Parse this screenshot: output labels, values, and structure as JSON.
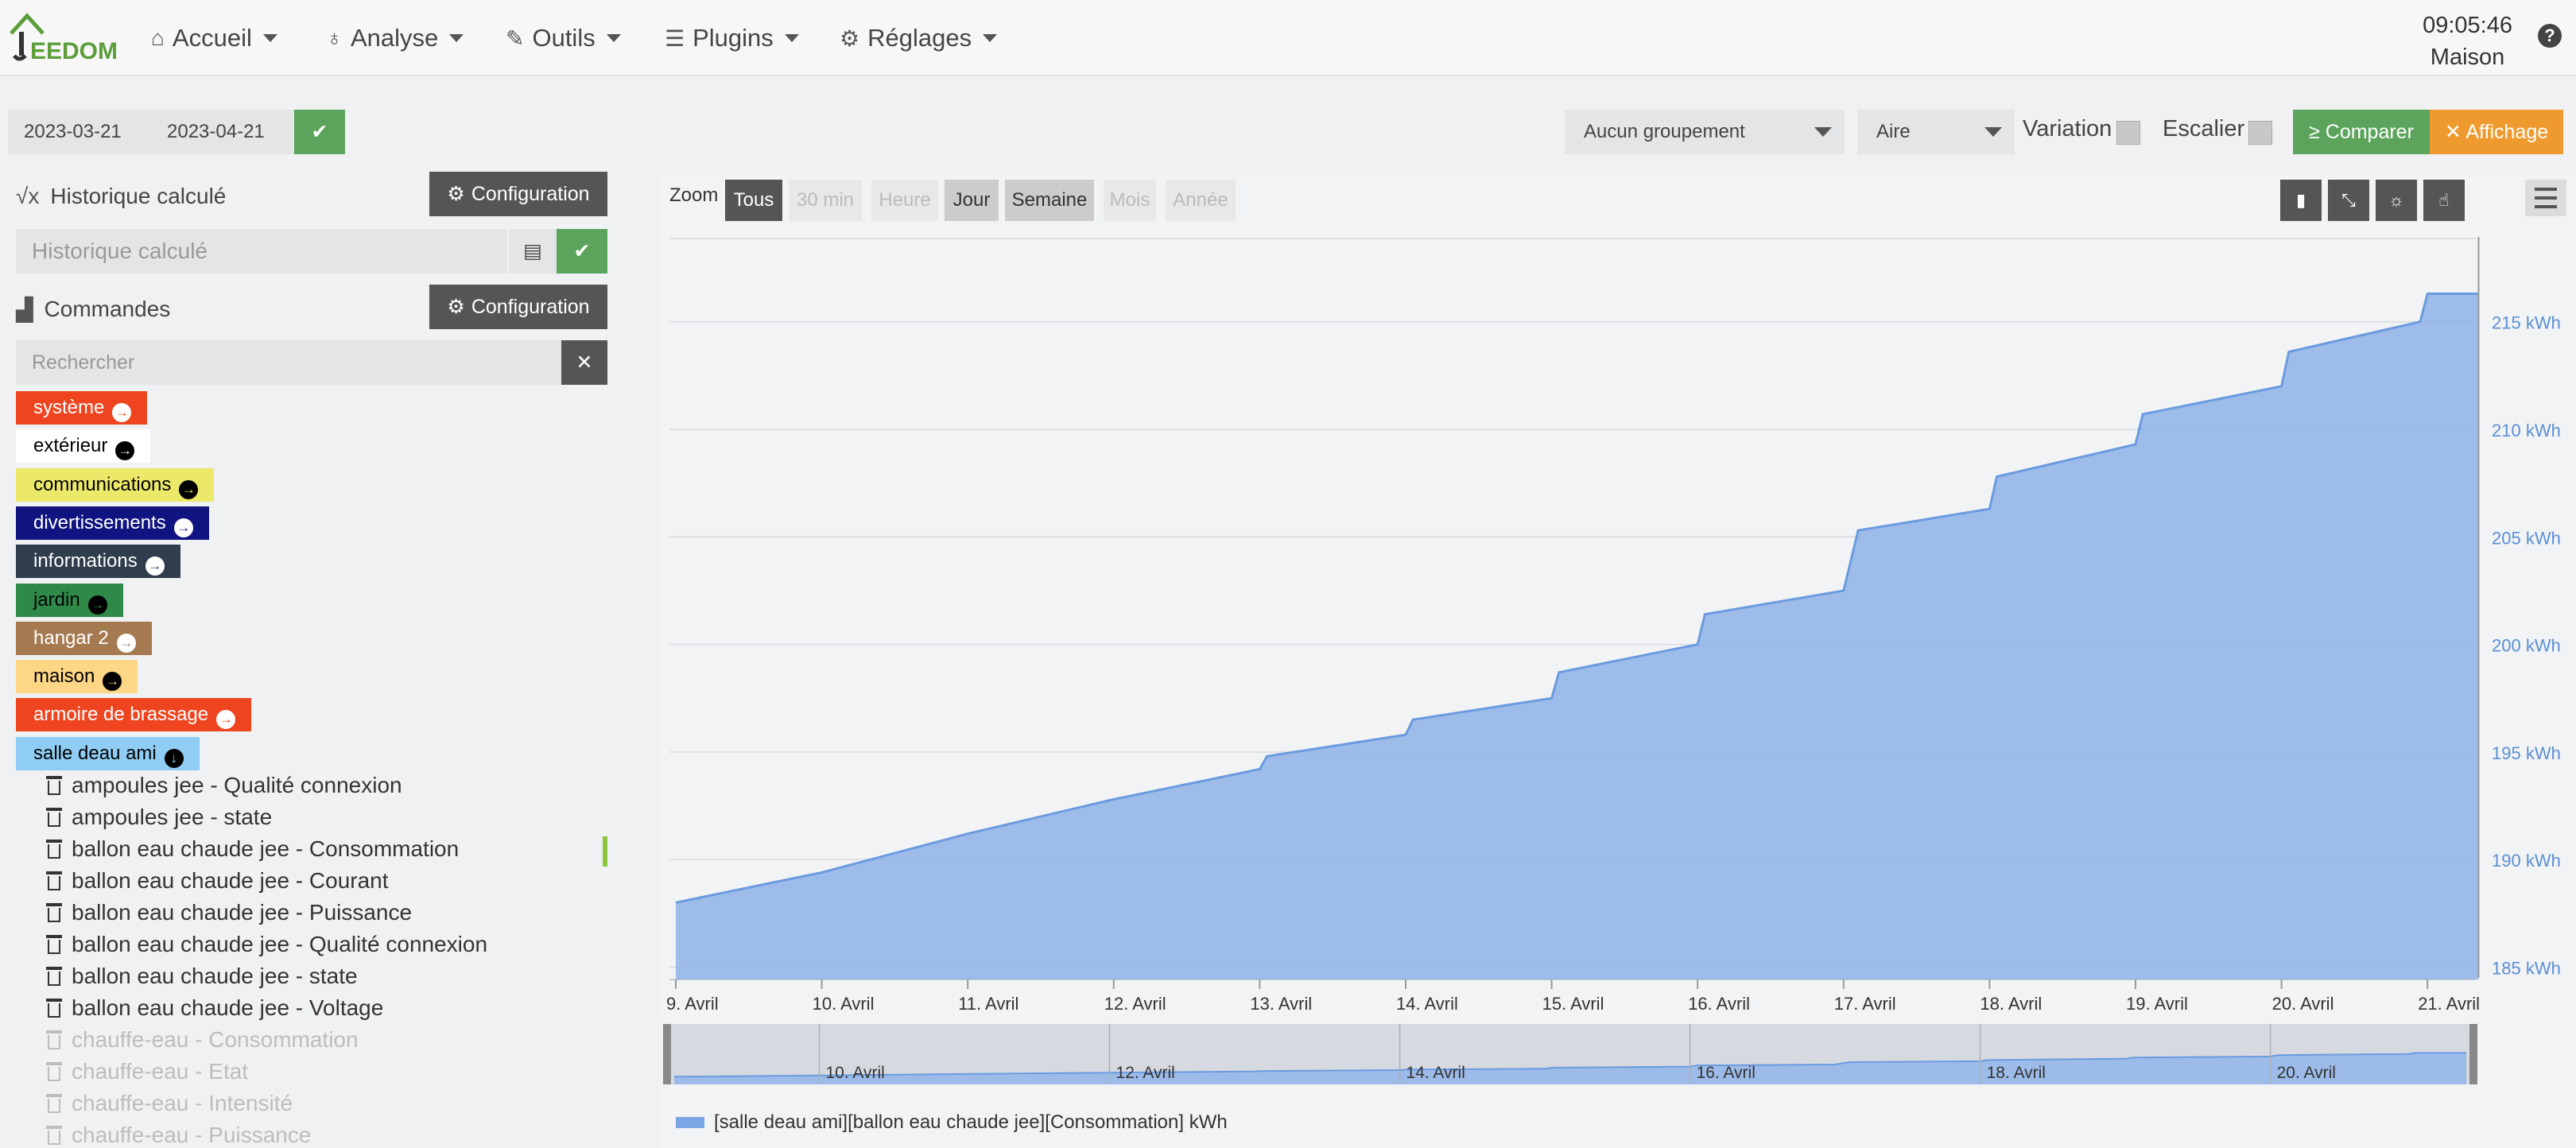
{
  "nav": {
    "logo_text": "EEDOM",
    "items": [
      {
        "label": "Accueil",
        "icon": "home-icon"
      },
      {
        "label": "Analyse",
        "icon": "stethoscope-icon"
      },
      {
        "label": "Outils",
        "icon": "wrench-icon"
      },
      {
        "label": "Plugins",
        "icon": "tasks-icon"
      },
      {
        "label": "Réglages",
        "icon": "cogs-icon"
      }
    ],
    "time": "09:05:46",
    "location": "Maison",
    "help_icon": "question-circle-icon"
  },
  "dates": {
    "start": "2023-03-21",
    "end": "2023-04-21"
  },
  "toolbar": {
    "grouping": "Aucun groupement",
    "chart_type": "Aire",
    "variation_label": "Variation",
    "escalier_label": "Escalier",
    "compare_label": "≥ Comparer",
    "affichage_label": "✕ Affichage"
  },
  "sidebar": {
    "calc_title": "Historique calculé",
    "config_label": "Configuration",
    "calc_placeholder": "Historique calculé",
    "commands_title": "Commandes",
    "search_placeholder": "Rechercher",
    "tags": [
      {
        "label": "système",
        "bg": "#ee4520",
        "fg": "#ffffff"
      },
      {
        "label": "extérieur",
        "bg": "#ffffff",
        "fg": "#000000"
      },
      {
        "label": "communications",
        "bg": "#ece86a",
        "fg": "#000000"
      },
      {
        "label": "divertissements",
        "bg": "#101480",
        "fg": "#ffffff"
      },
      {
        "label": "informations",
        "bg": "#2f3d4d",
        "fg": "#ffffff"
      },
      {
        "label": "jardin",
        "bg": "#2f8a4a",
        "fg": "#000000"
      },
      {
        "label": "hangar 2",
        "bg": "#a57a50",
        "fg": "#ffffff"
      },
      {
        "label": "maison",
        "bg": "#fdd786",
        "fg": "#000000"
      },
      {
        "label": "armoire de brassage",
        "bg": "#ee4520",
        "fg": "#ffffff"
      },
      {
        "label": "salle deau ami",
        "bg": "#90cdf4",
        "fg": "#000000"
      }
    ],
    "commands": [
      {
        "label": "ampoules jee - Qualité connexion",
        "dim": false
      },
      {
        "label": "ampoules jee - state",
        "dim": false
      },
      {
        "label": "ballon eau chaude jee - Consommation",
        "dim": false,
        "active": true
      },
      {
        "label": "ballon eau chaude jee - Courant",
        "dim": false
      },
      {
        "label": "ballon eau chaude jee - Puissance",
        "dim": false
      },
      {
        "label": "ballon eau chaude jee - Qualité connexion",
        "dim": false
      },
      {
        "label": "ballon eau chaude jee - state",
        "dim": false
      },
      {
        "label": "ballon eau chaude jee - Voltage",
        "dim": false
      },
      {
        "label": "chauffe-eau - Consommation",
        "dim": true
      },
      {
        "label": "chauffe-eau - Etat",
        "dim": true
      },
      {
        "label": "chauffe-eau - Intensité",
        "dim": true
      },
      {
        "label": "chauffe-eau - Puissance",
        "dim": true
      }
    ]
  },
  "zoom": {
    "label": "Zoom",
    "buttons": [
      {
        "label": "Tous",
        "state": "on"
      },
      {
        "label": "30 min",
        "state": "off"
      },
      {
        "label": "Heure",
        "state": "off"
      },
      {
        "label": "Jour",
        "state": "sel"
      },
      {
        "label": "Semaine",
        "state": "sel"
      },
      {
        "label": "Mois",
        "state": "off"
      },
      {
        "label": "Année",
        "state": "off"
      }
    ]
  },
  "chart_data": {
    "type": "area",
    "series": [
      {
        "name": "[salle deau ami][ballon eau chaude jee][Consommation] kWh",
        "color": "#7aa6e3",
        "points": [
          [
            0,
            188.0
          ],
          [
            1,
            189.4
          ],
          [
            2,
            191.2
          ],
          [
            3,
            192.8
          ],
          [
            4,
            194.2
          ],
          [
            4.05,
            194.8
          ],
          [
            5,
            195.8
          ],
          [
            5.05,
            196.5
          ],
          [
            6,
            197.5
          ],
          [
            6.05,
            198.7
          ],
          [
            7,
            200.0
          ],
          [
            7.05,
            201.4
          ],
          [
            8,
            202.5
          ],
          [
            8.1,
            205.3
          ],
          [
            9,
            206.3
          ],
          [
            9.05,
            207.8
          ],
          [
            10,
            209.3
          ],
          [
            10.05,
            210.7
          ],
          [
            11,
            212.0
          ],
          [
            11.05,
            213.6
          ],
          [
            11.95,
            215.0
          ],
          [
            12.0,
            216.3
          ],
          [
            12.35,
            216.3
          ]
        ]
      }
    ],
    "x_ticks": [
      "9. Avril",
      "10. Avril",
      "11. Avril",
      "12. Avril",
      "13. Avril",
      "14. Avril",
      "15. Avril",
      "16. Avril",
      "17. Avril",
      "18. Avril",
      "19. Avril",
      "20. Avril",
      "21. Avril"
    ],
    "y_ticks": [
      "185 kWh",
      "190 kWh",
      "195 kWh",
      "200 kWh",
      "205 kWh",
      "210 kWh",
      "215 kWh"
    ],
    "ylim": [
      184.5,
      218.5
    ],
    "navigator_ticks": [
      "10. Avril",
      "12. Avril",
      "14. Avril",
      "16. Avril",
      "18. Avril",
      "20. Avril"
    ],
    "grid": true
  }
}
